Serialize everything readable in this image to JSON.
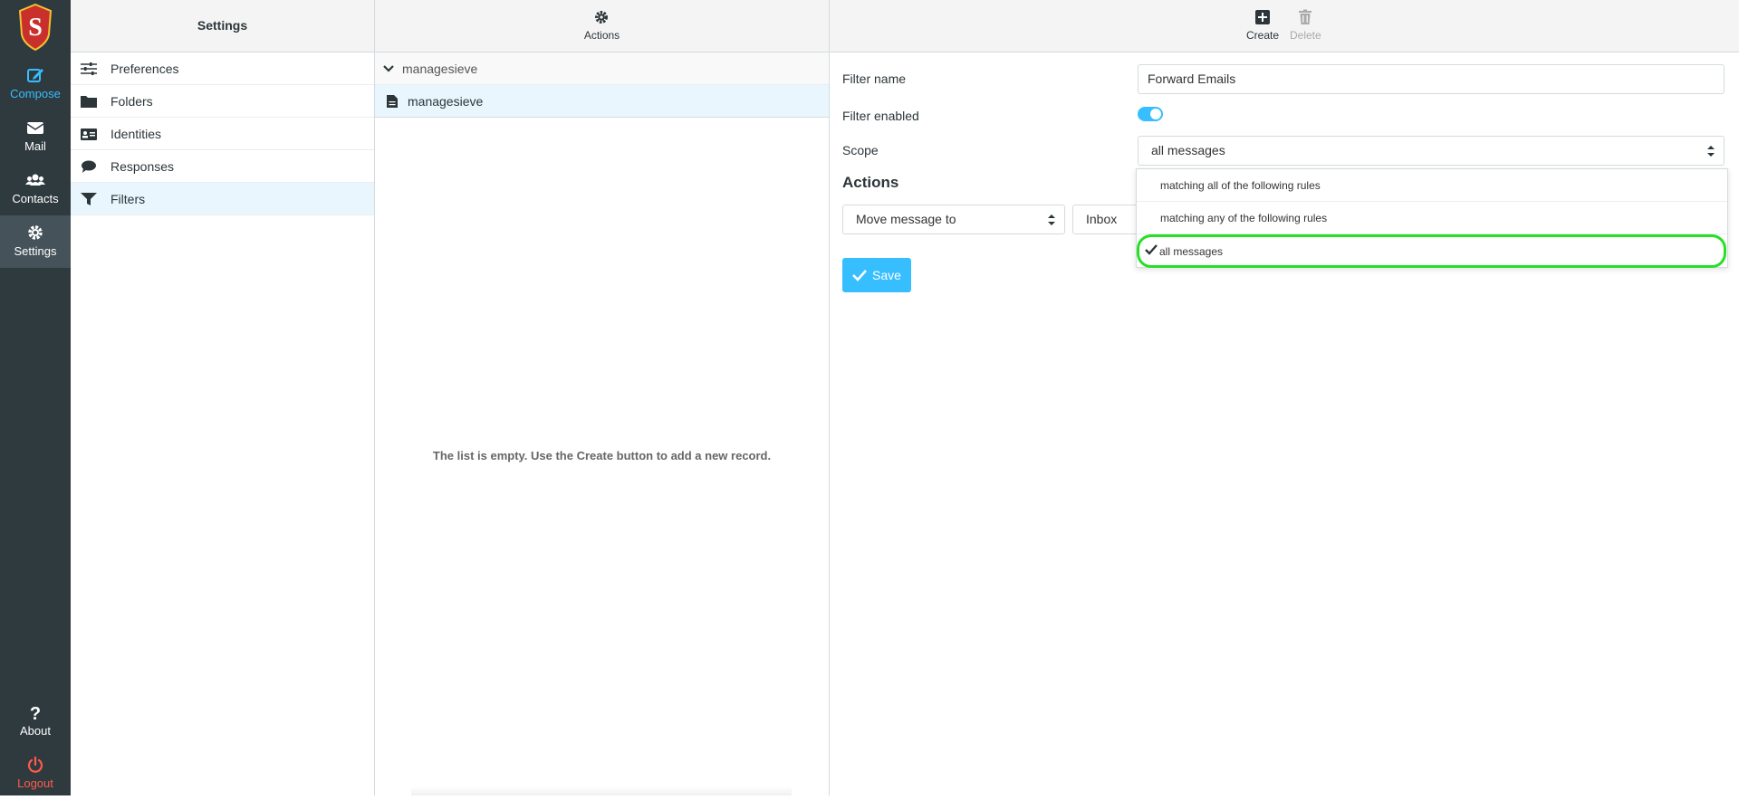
{
  "appnav": {
    "items": [
      {
        "label": "Compose",
        "icon": "compose-icon"
      },
      {
        "label": "Mail",
        "icon": "mail-icon"
      },
      {
        "label": "Contacts",
        "icon": "contacts-icon"
      },
      {
        "label": "Settings",
        "icon": "gear-icon"
      }
    ],
    "about_label": "About",
    "logout_label": "Logout"
  },
  "settings": {
    "title": "Settings",
    "items": [
      {
        "label": "Preferences",
        "icon": "sliders-icon"
      },
      {
        "label": "Folders",
        "icon": "folder-icon"
      },
      {
        "label": "Identities",
        "icon": "id-card-icon"
      },
      {
        "label": "Responses",
        "icon": "comment-icon"
      },
      {
        "label": "Filters",
        "icon": "filter-icon"
      }
    ]
  },
  "filtersets": {
    "actions_label": "Actions",
    "group_label": "managesieve",
    "set_label": "managesieve",
    "empty_message": "The list is empty. Use the Create button to add a new record."
  },
  "toolbar": {
    "create_label": "Create",
    "delete_label": "Delete"
  },
  "form": {
    "filter_name_label": "Filter name",
    "filter_name_value": "Forward Emails",
    "filter_enabled_label": "Filter enabled",
    "filter_enabled": true,
    "scope_label": "Scope",
    "scope_value": "all messages",
    "actions_heading": "Actions",
    "action_type": "Move message to",
    "action_folder": "Inbox",
    "save_label": "Save"
  },
  "scope_dropdown": {
    "options": [
      "matching all of the following rules",
      "matching any of the following rules",
      "all messages"
    ],
    "selected": "all messages"
  },
  "colors": {
    "accent": "#37beff",
    "nav_bg": "#2f3a3f",
    "logout": "#ff5b4a",
    "highlight": "#25e025"
  }
}
